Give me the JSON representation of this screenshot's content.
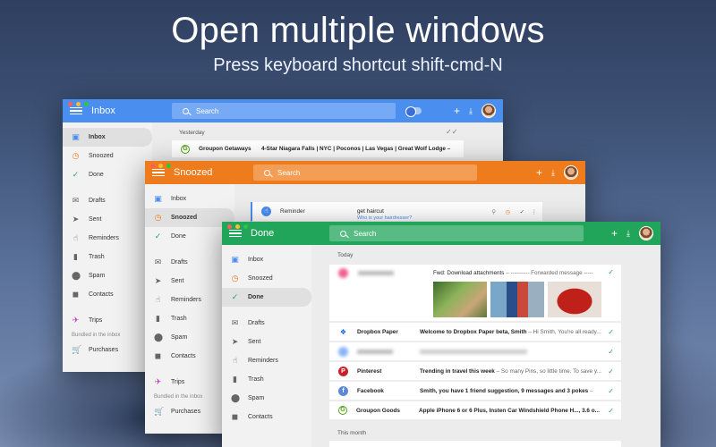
{
  "hero": {
    "title": "Open multiple windows",
    "subtitle": "Press keyboard shortcut shift-cmd-N"
  },
  "colors": {
    "inbox": "#4a8ef0",
    "snoozed": "#ef7c1c",
    "done": "#21a55a"
  },
  "inbox_window": {
    "title": "Inbox",
    "search_placeholder": "Search",
    "sidebar": [
      "Inbox",
      "Snoozed",
      "Done",
      "Drafts",
      "Sent",
      "Reminders",
      "Trash",
      "Spam",
      "Contacts",
      "Trips",
      "Bundled in the inbox",
      "Purchases"
    ],
    "section_label": "Yesterday",
    "row": {
      "sender": "Groupon Getaways",
      "subject": "4-Star Niagara Falls | NYC | Poconos | Las Vegas | Great Wolf Lodge –"
    }
  },
  "snoozed_window": {
    "title": "Snoozed",
    "search_placeholder": "Search",
    "sidebar": [
      "Inbox",
      "Snoozed",
      "Done",
      "Drafts",
      "Sent",
      "Reminders",
      "Trash",
      "Spam",
      "Contacts",
      "Trips",
      "Bundled in the inbox",
      "Purchases"
    ],
    "reminder": {
      "label": "Reminder",
      "title": "get haircut",
      "subtitle": "Who is your hairdresser?"
    }
  },
  "done_window": {
    "title": "Done",
    "search_placeholder": "Search",
    "sidebar": [
      "Inbox",
      "Snoozed",
      "Done",
      "Drafts",
      "Sent",
      "Reminders",
      "Trash",
      "Spam",
      "Contacts"
    ],
    "section_today": "Today",
    "section_month": "This month",
    "attachment_row": {
      "subject": "Fwd: Download attachments",
      "snippet": " – ---------- Forwarded message -----"
    },
    "rows": [
      {
        "sender": "Dropbox Paper",
        "subject": "Welcome to Dropbox Paper beta, Smith",
        "snippet": " – Hi Smith, You're all ready..."
      },
      {
        "sender": "Pinterest",
        "subject": "Trending in travel this week",
        "snippet": " – So many Pins, so little time. To save y..."
      },
      {
        "sender": "Facebook",
        "subject": "Smith, you have 1 friend suggestion, 9 messages and 3 pokes",
        "snippet": " –"
      },
      {
        "sender": "Groupon Goods",
        "subject": "Apple iPhone 6 or 6 Plus, Insten Car Windshield Phone H..., 3.6 o...",
        "snippet": ""
      }
    ]
  }
}
